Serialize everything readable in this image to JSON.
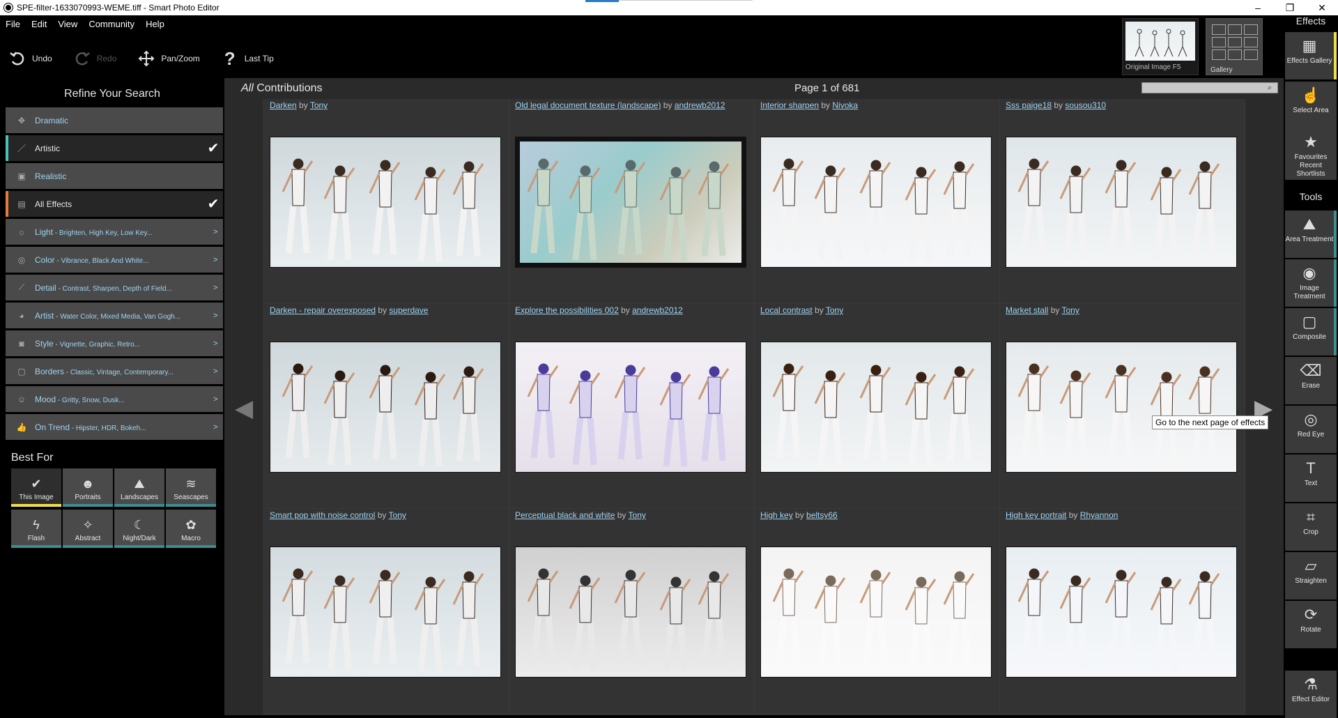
{
  "window": {
    "title": "SPE-filter-1633070993-WEME.tiff - Smart Photo Editor",
    "controls": [
      "–",
      "❐",
      "✕"
    ]
  },
  "menu": [
    "File",
    "Edit",
    "View",
    "Community",
    "Help"
  ],
  "toolbar": {
    "undo": "Undo",
    "redo": "Redo",
    "panzoom": "Pan/Zoom",
    "lasttip": "Last Tip"
  },
  "top_right": {
    "original_caption": "Original Image F5",
    "gallery_caption": "Gallery"
  },
  "sidebar": {
    "title": "Refine Your Search",
    "categories": [
      {
        "label": "Dramatic",
        "sub": "",
        "check": false,
        "arrow": false
      },
      {
        "label": "Artistic",
        "sub": "",
        "check": true,
        "arrow": false
      },
      {
        "label": "Realistic",
        "sub": "",
        "check": false,
        "arrow": false
      },
      {
        "label": "All Effects",
        "sub": "",
        "check": true,
        "arrow": false
      },
      {
        "label": "Light",
        "sub": " - Brighten, High Key, Low Key...",
        "check": false,
        "arrow": true
      },
      {
        "label": "Color",
        "sub": " - Vibrance, Black And White...",
        "check": false,
        "arrow": true
      },
      {
        "label": "Detail",
        "sub": " - Contrast, Sharpen, Depth of Field...",
        "check": false,
        "arrow": true
      },
      {
        "label": "Artist",
        "sub": " - Water Color, Mixed Media, Van Gogh...",
        "check": false,
        "arrow": true
      },
      {
        "label": "Style",
        "sub": " - Vignette, Graphic, Retro...",
        "check": false,
        "arrow": true
      },
      {
        "label": "Borders",
        "sub": " - Classic, Vintage, Contemporary...",
        "check": false,
        "arrow": true
      },
      {
        "label": "Mood",
        "sub": " - Gritty, Snow, Dusk...",
        "check": false,
        "arrow": true
      },
      {
        "label": "On Trend",
        "sub": " - Hipster, HDR, Bokeh...",
        "check": false,
        "arrow": true
      }
    ],
    "best_for_title": "Best For",
    "best_for": [
      "This Image",
      "Portraits",
      "Landscapes",
      "Seascapes",
      "Flash",
      "Abstract",
      "Night/Dark",
      "Macro"
    ],
    "arrow_glyph": ">",
    "check_glyph": "✔"
  },
  "main": {
    "contrib_prefix": "All",
    "contrib_label": " Contributions",
    "page_info": "Page 1 of 681",
    "by": " by ",
    "effects": [
      {
        "name": "Darken",
        "author": "Tony"
      },
      {
        "name": "Old legal document texture (landscape)",
        "author": "andrewb2012"
      },
      {
        "name": "Interior sharpen",
        "author": "Nivoka"
      },
      {
        "name": "Sss paige18",
        "author": "sousou310"
      },
      {
        "name": "Darken - repair overexposed",
        "author": "superdave"
      },
      {
        "name": "Explore the possibilities 002",
        "author": "andrewb2012"
      },
      {
        "name": "Local contrast",
        "author": "Tony"
      },
      {
        "name": "Market stall",
        "author": "Tony"
      },
      {
        "name": "Smart pop with noise control",
        "author": "Tony"
      },
      {
        "name": "Perceptual black and white",
        "author": "Tony"
      },
      {
        "name": "High key",
        "author": "beltsy66"
      },
      {
        "name": "High key portrait",
        "author": "Rhyannon"
      }
    ],
    "tooltip": "Go to the next page of effects"
  },
  "right_panel": {
    "effects_title": "Effects",
    "tools_title": "Tools",
    "buttons": [
      "Effects Gallery",
      "Select Area",
      "Favourites Recent Shortlists",
      "Area Treatment",
      "Image Treatment",
      "Composite",
      "Erase",
      "Red Eye",
      "Text",
      "Crop",
      "Straighten",
      "Rotate",
      "Effect Editor"
    ]
  }
}
